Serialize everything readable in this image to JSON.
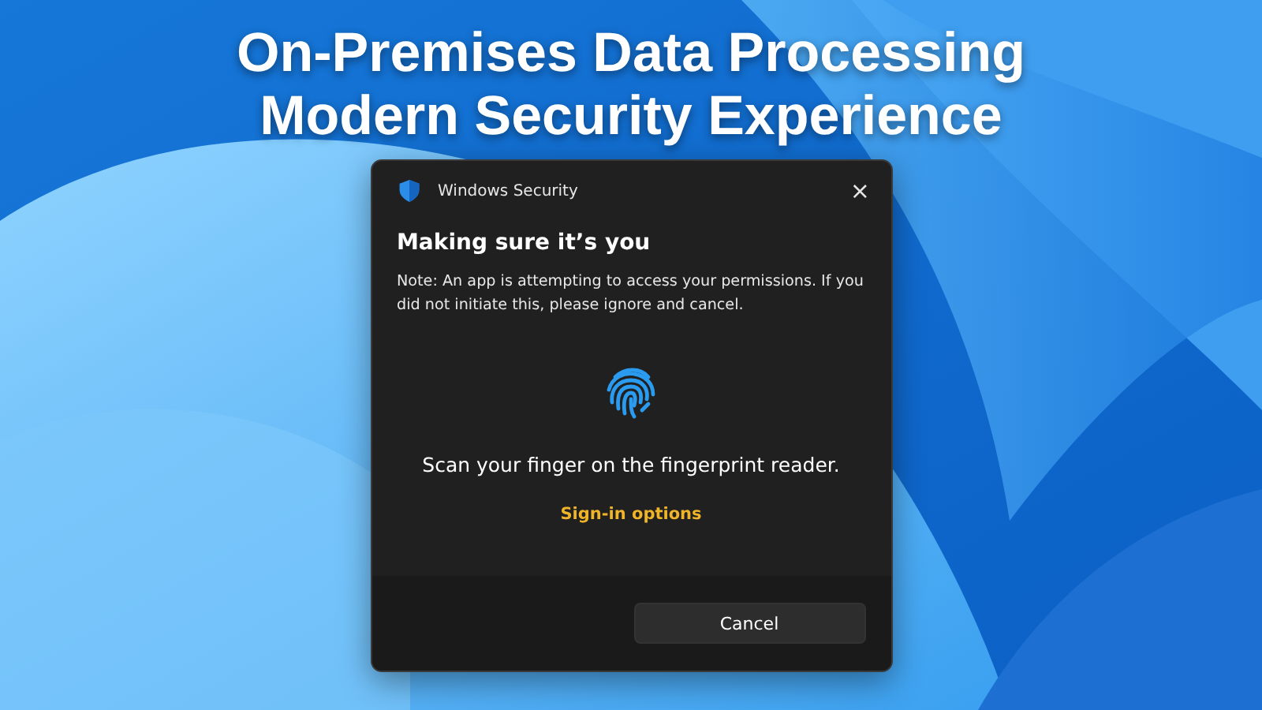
{
  "headline": [
    "On-Premises Data Processing",
    "Modern Security Experience"
  ],
  "dialog": {
    "title": "Windows Security",
    "close": "×",
    "heading": "Making sure it’s you",
    "note": "Note: An app is attempting to access your permissions. If you did not initiate this, please ignore and cancel.",
    "prompt": "Scan your finger on the fingerprint reader.",
    "link": "Sign-in options",
    "buttons": [
      "Cancel"
    ]
  }
}
